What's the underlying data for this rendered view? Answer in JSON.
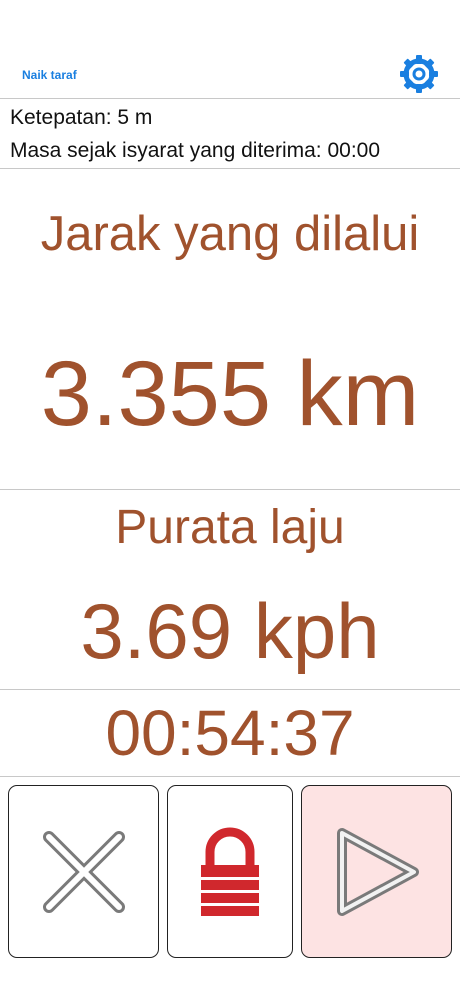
{
  "header": {
    "upgrade_label": "Naik taraf",
    "settings_icon": "gear-icon",
    "accent_color": "#1a7fe0"
  },
  "status": {
    "accuracy": "Ketepatan: 5 m",
    "time_since_signal": "Masa sejak isyarat yang diterima: 00:00"
  },
  "distance": {
    "label": "Jarak yang dilalui",
    "value": "3.355 km"
  },
  "average_speed": {
    "label": "Purata laju",
    "value": "3.69 kph"
  },
  "timer": {
    "elapsed": "00:54:37"
  },
  "controls": {
    "cancel_icon": "close-icon",
    "lock_icon": "lock-icon",
    "play_icon": "play-icon"
  },
  "colors": {
    "text_brown": "#a0522d",
    "lock_red": "#d0282d",
    "play_bg": "#fde3e3"
  }
}
